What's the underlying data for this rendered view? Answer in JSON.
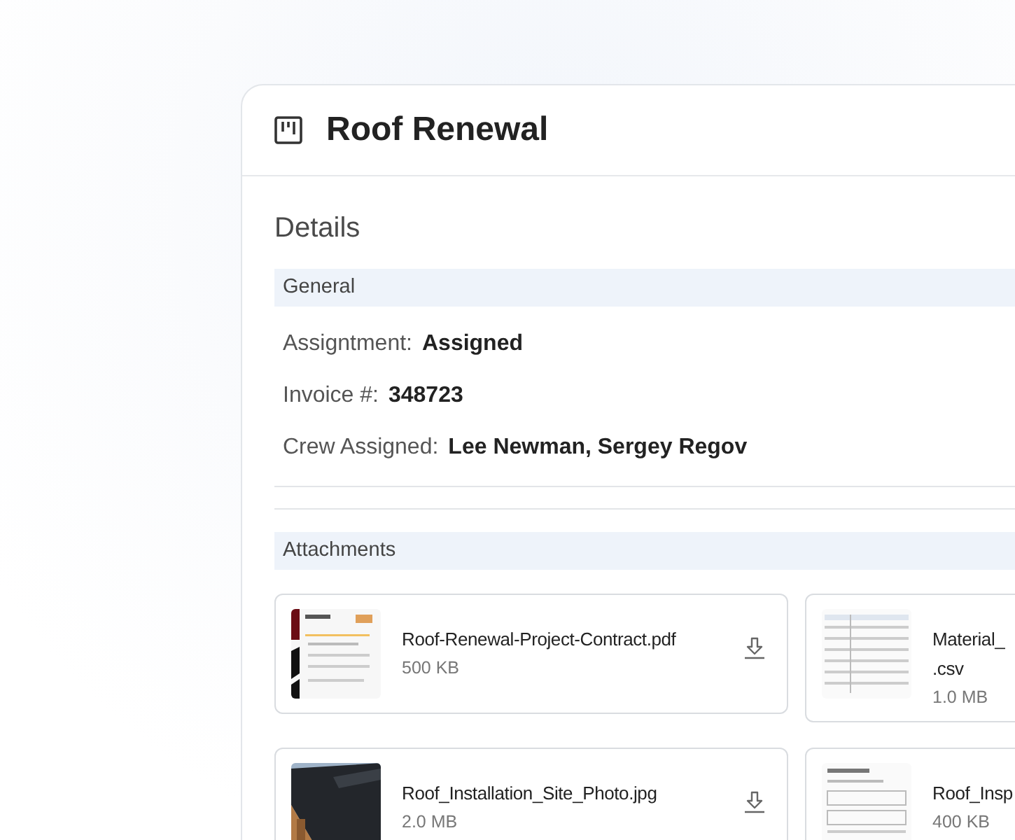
{
  "panel": {
    "title": "Roof Renewal"
  },
  "details": {
    "heading": "Details",
    "general": {
      "heading": "General",
      "fields": [
        {
          "label": "Assigntment:",
          "value": "Assigned"
        },
        {
          "label": "Invoice #:",
          "value": "348723"
        },
        {
          "label": "Crew Assigned:",
          "value": "Lee Newman, Sergey Regov"
        }
      ]
    },
    "attachments": {
      "heading": "Attachments",
      "files": [
        {
          "name": "Roof-Renewal-Project-Contract.pdf",
          "size": "500 KB",
          "download": true
        },
        {
          "name": "Material_",
          "name_tail": ".csv",
          "size": "1.0 MB",
          "download": false
        },
        {
          "name": "Roof_Installation_Site_Photo.jpg",
          "size": "2.0 MB",
          "download": true
        },
        {
          "name": "Roof_Insp",
          "size": "400 KB",
          "download": false
        }
      ]
    }
  }
}
